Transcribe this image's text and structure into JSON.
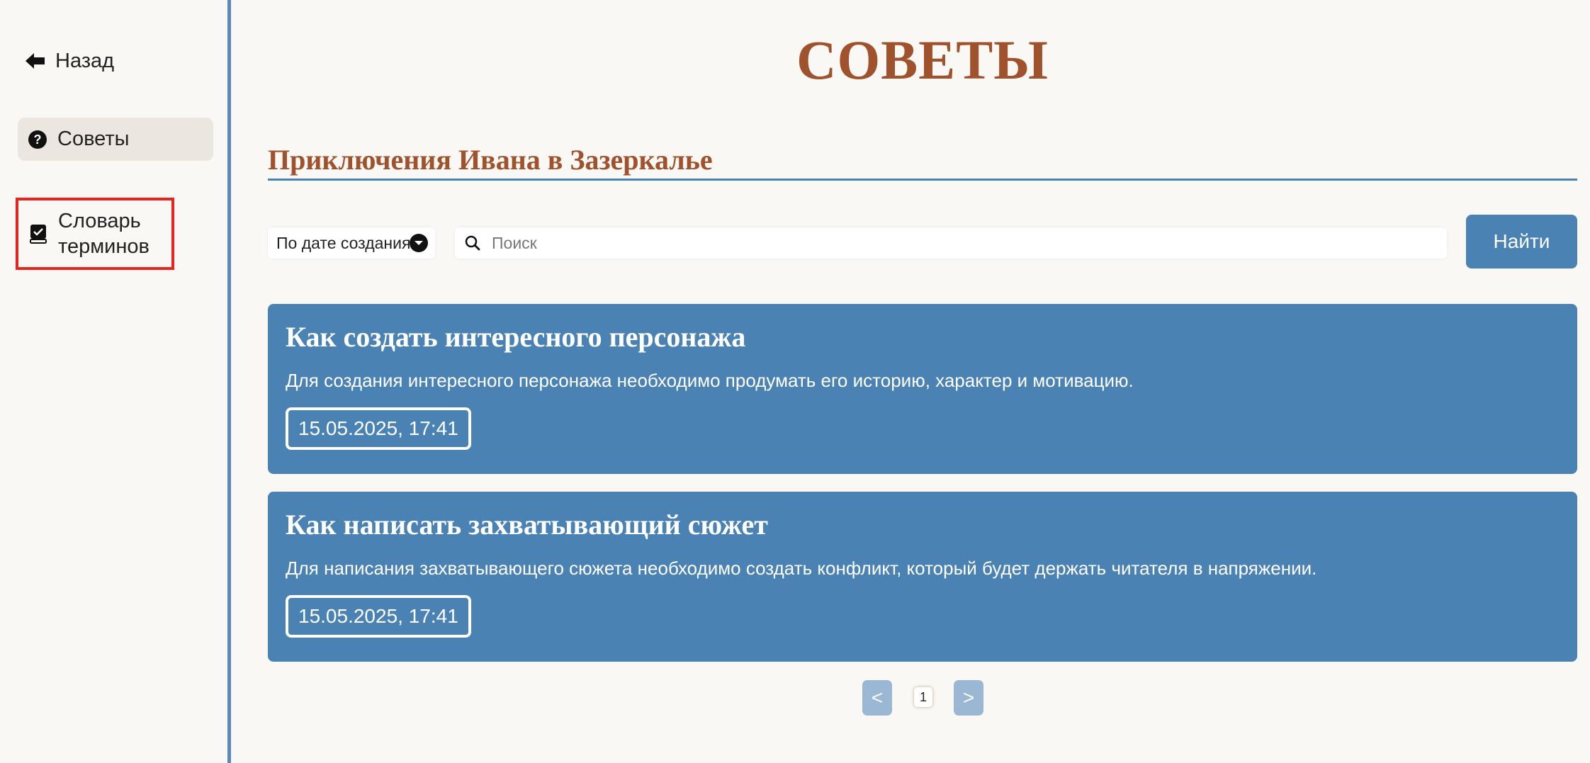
{
  "sidebar": {
    "back_label": "Назад",
    "tips_label": "Советы",
    "dict_label": "Словарь терминов",
    "accent_color": "#5b88bf",
    "highlight_color": "#e8241e"
  },
  "header": {
    "title": "СОВЕТЫ",
    "book_title": "Приключения Ивана в Зазеркалье"
  },
  "toolbar": {
    "sort_value": "По дате создания",
    "search_placeholder": "Поиск",
    "search_value": "",
    "find_label": "Найти"
  },
  "cards": [
    {
      "title": "Как создать интересного персонажа",
      "text": "Для создания интересного персонажа необходимо продумать его историю, характер и мотивацию.",
      "date": "15.05.2025, 17:41"
    },
    {
      "title": "Как написать захватывающий сюжет",
      "text": "Для написания захватывающего сюжета необходимо создать конфликт, который будет держать читателя в напряжении.",
      "date": "15.05.2025, 17:41"
    }
  ],
  "pagination": {
    "prev_label": "<",
    "current_page": "1",
    "next_label": ">"
  },
  "colors": {
    "brand": "#4a82b4",
    "heading": "#a0522d",
    "background": "#faf8f5"
  }
}
